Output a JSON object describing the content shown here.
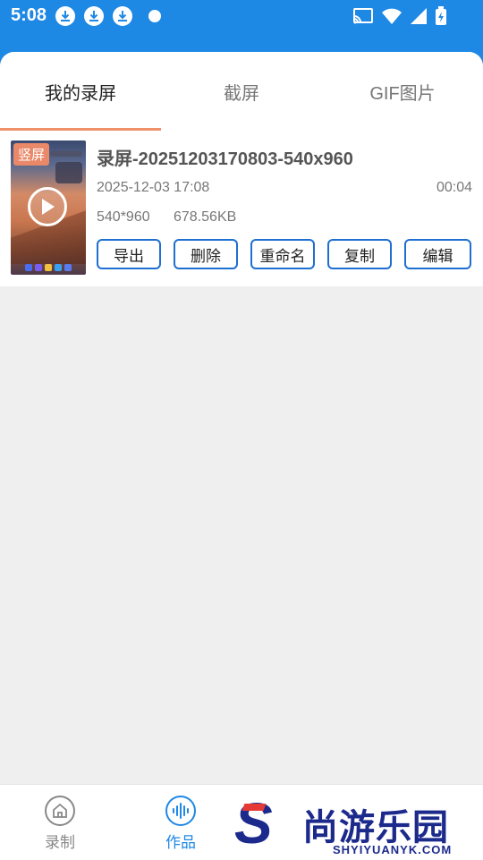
{
  "status_bar": {
    "time": "5:08",
    "left_icons": [
      "download-icon",
      "download-icon",
      "download-icon",
      "dot-icon"
    ],
    "right_icons": [
      "cast-icon",
      "wifi-icon",
      "signal-icon",
      "battery-charging-icon"
    ]
  },
  "tabs": [
    {
      "label": "我的录屏",
      "active": true
    },
    {
      "label": "截屏",
      "active": false
    },
    {
      "label": "GIF图片",
      "active": false
    }
  ],
  "media_item": {
    "badge": "竖屏",
    "title": "录屏-20251203170803-540x960",
    "date": "2025-12-03 17:08",
    "duration": "00:04",
    "resolution": "540*960",
    "size": "678.56KB",
    "actions": [
      "导出",
      "删除",
      "重命名",
      "复制",
      "编辑"
    ]
  },
  "bottom_nav": [
    {
      "label": "录制",
      "icon": "home-icon",
      "active": false
    },
    {
      "label": "作品",
      "icon": "audio-wave-icon",
      "active": true
    }
  ],
  "watermark": {
    "text": "尚游乐园",
    "url": "SHYIYUANYK.COM"
  },
  "colors": {
    "primary": "#1e88e5",
    "accent": "#f0906a",
    "button_border": "#1e6fd0"
  }
}
